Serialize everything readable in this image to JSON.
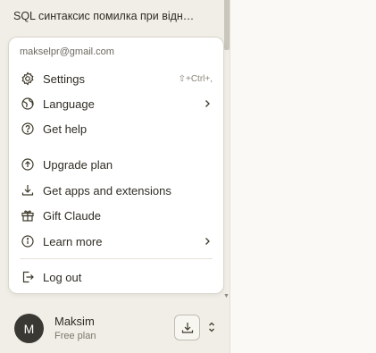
{
  "sidebar": {
    "conversation_title": "SQL синтаксис помилка при відн…"
  },
  "menu": {
    "email": "makselpr@gmail.com",
    "settings_label": "Settings",
    "settings_shortcut": "⇧+Ctrl+,",
    "language_label": "Language",
    "get_help_label": "Get help",
    "upgrade_label": "Upgrade plan",
    "apps_label": "Get apps and extensions",
    "gift_label": "Gift Claude",
    "learn_more_label": "Learn more",
    "logout_label": "Log out"
  },
  "account": {
    "avatar_initial": "M",
    "name": "Maksim",
    "plan": "Free plan"
  },
  "icons": {
    "settings": "gear-icon",
    "language": "globe-icon",
    "help": "question-circle-icon",
    "upgrade": "arrow-up-circle-icon",
    "apps": "download-icon",
    "gift": "gift-icon",
    "learn": "info-circle-icon",
    "logout": "logout-icon"
  },
  "colors": {
    "sidebar_bg": "#f0eee6",
    "page_bg": "#faf9f5",
    "menu_bg": "#ffffff",
    "avatar_bg": "#3a3833"
  }
}
